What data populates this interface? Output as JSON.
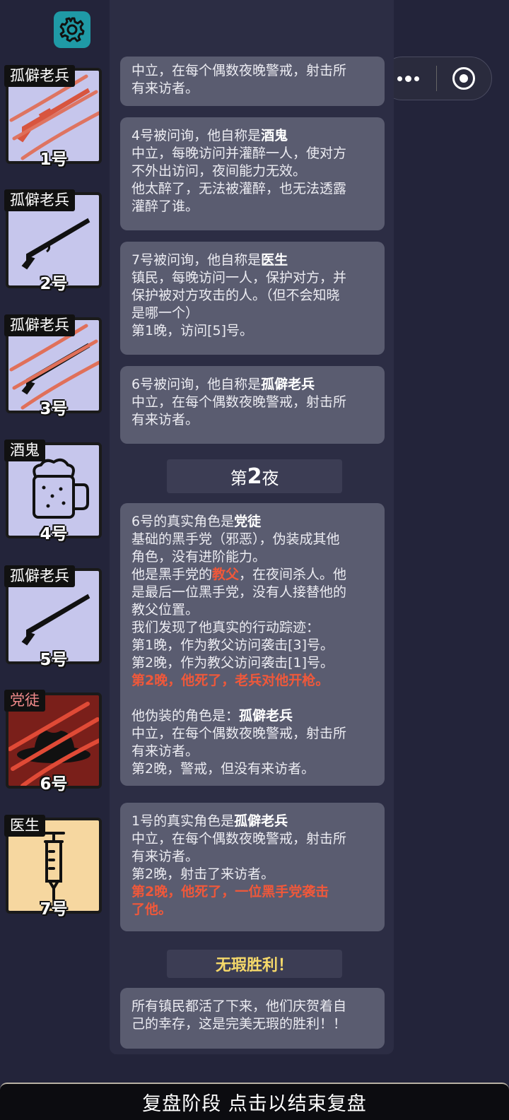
{
  "colors": {
    "background": "#23243a",
    "panel": "#2c2d44",
    "card": "#5a5c70",
    "highlight_red": "#f0583a",
    "victory_gold": "#f6d96a"
  },
  "toolbar": {
    "settings_icon": "gear-icon",
    "more_icon": "more-dots-icon",
    "close_icon": "target-close-icon"
  },
  "players": [
    {
      "role": "孤僻老兵",
      "number": "1号",
      "icon": "rifle-icon",
      "dead": true
    },
    {
      "role": "孤僻老兵",
      "number": "2号",
      "icon": "rifle-icon",
      "dead": false
    },
    {
      "role": "孤僻老兵",
      "number": "3号",
      "icon": "rifle-icon",
      "dead": true
    },
    {
      "role": "酒鬼",
      "number": "4号",
      "icon": "beer-mug-icon",
      "dead": false
    },
    {
      "role": "孤僻老兵",
      "number": "5号",
      "icon": "rifle-icon",
      "dead": false
    },
    {
      "role": "党徒",
      "number": "6号",
      "icon": "fedora-hat-icon",
      "dead": true
    },
    {
      "role": "医生",
      "number": "7号",
      "icon": "syringe-icon",
      "dead": false
    }
  ],
  "log": {
    "m0": {
      "l1": "中立，在每个偶数夜晚警戒，射击所",
      "l2": "有来访者。"
    },
    "m1": {
      "intro": "4号被问询，他自称是",
      "role": "酒鬼",
      "l1": "中立，每晚访问并灌醉一人，使对方",
      "l2": "不外出访问，夜间能力无效。",
      "l3": "他太醉了，无法被灌醉，也无法透露",
      "l4": "灌醉了谁。"
    },
    "m2": {
      "intro": "7号被问询，他自称是",
      "role": "医生",
      "l1": "镇民，每晚访问一人，保护对方，并",
      "l2": "保护被对方攻击的人。（但不会知晓",
      "l3": "是哪一个）",
      "l4": "第1晚，访问[5]号。"
    },
    "m3": {
      "intro": "6号被问询，他自称是",
      "role": "孤僻老兵",
      "l1": "中立，在每个偶数夜晚警戒，射击所",
      "l2": "有来访者。"
    },
    "night2": {
      "pre": "第",
      "num": "2",
      "post": "夜"
    },
    "m4": {
      "intro": "6号的真实角色是",
      "role": "党徒",
      "l1": "基础的黑手党（邪恶），伪装成其他",
      "l2": "角色，没有进阶能力。",
      "l3a": "他是黑手党的",
      "l3b": "教父",
      "l3c": "，在夜间杀人。他",
      "l4": "是最后一位黑手党，没有人接替他的",
      "l5": "教父位置。",
      "l6": "我们发现了他真实的行动踪迹：",
      "l7": "第1晚，作为教父访问袭击[3]号。",
      "l8": "第2晚，作为教父访问袭击[1]号。",
      "l9": "第2晚，他死了，老兵对他开枪。",
      "l10a": "他伪装的角色是：",
      "l10b": "孤僻老兵",
      "l11": "中立，在每个偶数夜晚警戒，射击所",
      "l12": "有来访者。",
      "l13": "第2晚，警戒，但没有来访者。"
    },
    "m5": {
      "intro": "1号的真实角色是",
      "role": "孤僻老兵",
      "l1": "中立，在每个偶数夜晚警戒，射击所",
      "l2": "有来访者。",
      "l3": "第2晚，射击了来访者。",
      "l4": "第2晚，他死了，一位黑手党袭击",
      "l5": "了他。"
    },
    "victory": "无瑕胜利！",
    "m6": {
      "l1": "所有镇民都活了下来，他们庆贺着自",
      "l2": "己的幸存，这是完美无瑕的胜利！！"
    }
  },
  "bottom_bar": "复盘阶段 点击以结束复盘"
}
